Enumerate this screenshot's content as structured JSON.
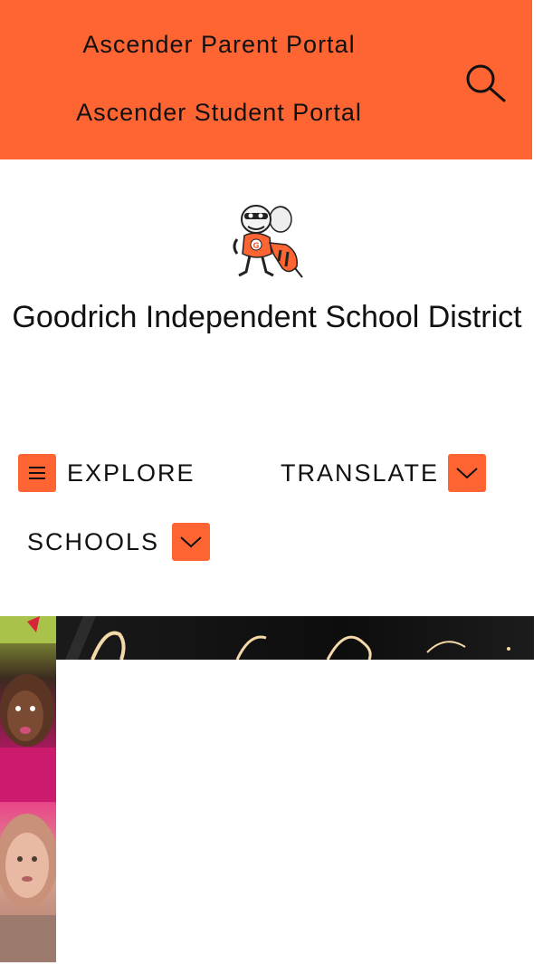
{
  "header": {
    "portal_links": [
      {
        "label": "Ascender Parent Portal"
      },
      {
        "label": "Ascender Student Portal"
      }
    ],
    "search_icon": "search-icon",
    "background_color": "#ff6433"
  },
  "branding": {
    "logo_icon": "hornet-mascot-logo",
    "district_name": "Goodrich Independent School District"
  },
  "nav": {
    "explore_label": "EXPLORE",
    "explore_icon": "hamburger-menu-icon",
    "translate_label": "TRANSLATE",
    "translate_icon": "chevron-down-icon",
    "schools_label": "SCHOOLS",
    "schools_icon": "chevron-down-icon",
    "accent_color": "#ff6433"
  },
  "hero": {
    "slide_image": "students-photo",
    "banner_image": "neon-sign-banner"
  }
}
